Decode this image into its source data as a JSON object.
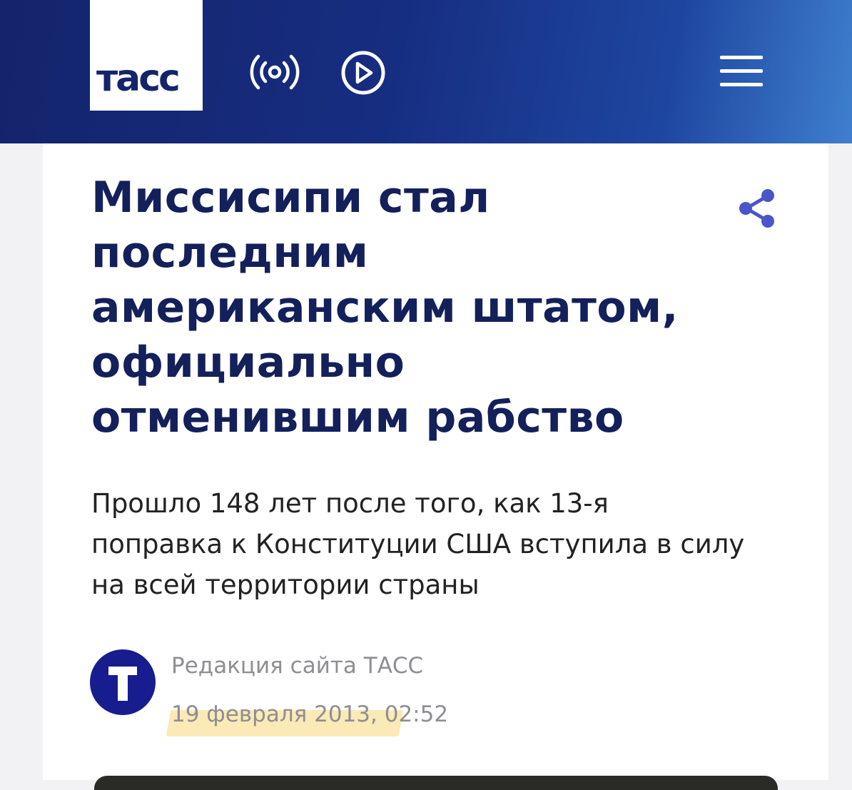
{
  "header": {
    "logo_text": "тасс",
    "colors": {
      "gradient_start": "#14246b",
      "gradient_end": "#3f7fce",
      "logo_bg": "#ffffff"
    },
    "icons": [
      "radio-icon",
      "play-icon",
      "menu-icon"
    ]
  },
  "article": {
    "title": "Миссисипи стал последним американским штатом, официально отменившим рабство",
    "lead": "Прошло 148 лет после того, как 13-я поправка к Конституции США вступила в силу на всей территории страны",
    "author": "Редакция сайта ТАСС",
    "avatar_letter": "T",
    "date": "19 февраля 2013, 02:52",
    "colors": {
      "title": "#14205a",
      "accent": "#4a55c8",
      "avatar": "#171c8f",
      "date_highlight": "#fbeab6"
    },
    "icons": [
      "share-icon"
    ]
  }
}
